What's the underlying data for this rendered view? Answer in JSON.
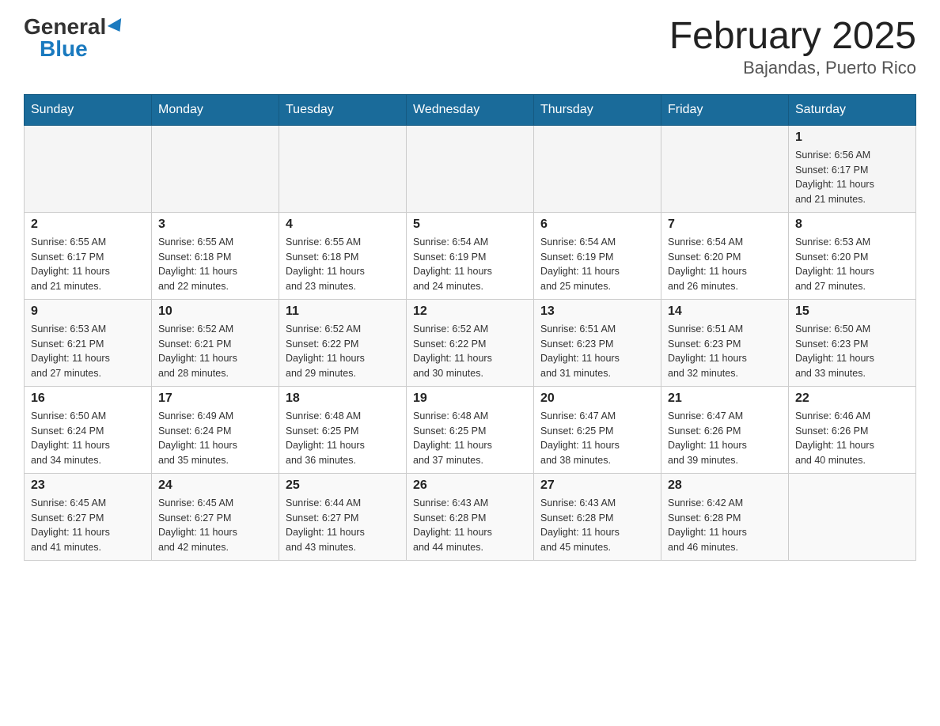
{
  "header": {
    "logo_general": "General",
    "logo_blue": "Blue",
    "title": "February 2025",
    "subtitle": "Bajandas, Puerto Rico"
  },
  "weekdays": [
    "Sunday",
    "Monday",
    "Tuesday",
    "Wednesday",
    "Thursday",
    "Friday",
    "Saturday"
  ],
  "weeks": [
    {
      "days": [
        {
          "num": "",
          "info": ""
        },
        {
          "num": "",
          "info": ""
        },
        {
          "num": "",
          "info": ""
        },
        {
          "num": "",
          "info": ""
        },
        {
          "num": "",
          "info": ""
        },
        {
          "num": "",
          "info": ""
        },
        {
          "num": "1",
          "info": "Sunrise: 6:56 AM\nSunset: 6:17 PM\nDaylight: 11 hours\nand 21 minutes."
        }
      ]
    },
    {
      "days": [
        {
          "num": "2",
          "info": "Sunrise: 6:55 AM\nSunset: 6:17 PM\nDaylight: 11 hours\nand 21 minutes."
        },
        {
          "num": "3",
          "info": "Sunrise: 6:55 AM\nSunset: 6:18 PM\nDaylight: 11 hours\nand 22 minutes."
        },
        {
          "num": "4",
          "info": "Sunrise: 6:55 AM\nSunset: 6:18 PM\nDaylight: 11 hours\nand 23 minutes."
        },
        {
          "num": "5",
          "info": "Sunrise: 6:54 AM\nSunset: 6:19 PM\nDaylight: 11 hours\nand 24 minutes."
        },
        {
          "num": "6",
          "info": "Sunrise: 6:54 AM\nSunset: 6:19 PM\nDaylight: 11 hours\nand 25 minutes."
        },
        {
          "num": "7",
          "info": "Sunrise: 6:54 AM\nSunset: 6:20 PM\nDaylight: 11 hours\nand 26 minutes."
        },
        {
          "num": "8",
          "info": "Sunrise: 6:53 AM\nSunset: 6:20 PM\nDaylight: 11 hours\nand 27 minutes."
        }
      ]
    },
    {
      "days": [
        {
          "num": "9",
          "info": "Sunrise: 6:53 AM\nSunset: 6:21 PM\nDaylight: 11 hours\nand 27 minutes."
        },
        {
          "num": "10",
          "info": "Sunrise: 6:52 AM\nSunset: 6:21 PM\nDaylight: 11 hours\nand 28 minutes."
        },
        {
          "num": "11",
          "info": "Sunrise: 6:52 AM\nSunset: 6:22 PM\nDaylight: 11 hours\nand 29 minutes."
        },
        {
          "num": "12",
          "info": "Sunrise: 6:52 AM\nSunset: 6:22 PM\nDaylight: 11 hours\nand 30 minutes."
        },
        {
          "num": "13",
          "info": "Sunrise: 6:51 AM\nSunset: 6:23 PM\nDaylight: 11 hours\nand 31 minutes."
        },
        {
          "num": "14",
          "info": "Sunrise: 6:51 AM\nSunset: 6:23 PM\nDaylight: 11 hours\nand 32 minutes."
        },
        {
          "num": "15",
          "info": "Sunrise: 6:50 AM\nSunset: 6:23 PM\nDaylight: 11 hours\nand 33 minutes."
        }
      ]
    },
    {
      "days": [
        {
          "num": "16",
          "info": "Sunrise: 6:50 AM\nSunset: 6:24 PM\nDaylight: 11 hours\nand 34 minutes."
        },
        {
          "num": "17",
          "info": "Sunrise: 6:49 AM\nSunset: 6:24 PM\nDaylight: 11 hours\nand 35 minutes."
        },
        {
          "num": "18",
          "info": "Sunrise: 6:48 AM\nSunset: 6:25 PM\nDaylight: 11 hours\nand 36 minutes."
        },
        {
          "num": "19",
          "info": "Sunrise: 6:48 AM\nSunset: 6:25 PM\nDaylight: 11 hours\nand 37 minutes."
        },
        {
          "num": "20",
          "info": "Sunrise: 6:47 AM\nSunset: 6:25 PM\nDaylight: 11 hours\nand 38 minutes."
        },
        {
          "num": "21",
          "info": "Sunrise: 6:47 AM\nSunset: 6:26 PM\nDaylight: 11 hours\nand 39 minutes."
        },
        {
          "num": "22",
          "info": "Sunrise: 6:46 AM\nSunset: 6:26 PM\nDaylight: 11 hours\nand 40 minutes."
        }
      ]
    },
    {
      "days": [
        {
          "num": "23",
          "info": "Sunrise: 6:45 AM\nSunset: 6:27 PM\nDaylight: 11 hours\nand 41 minutes."
        },
        {
          "num": "24",
          "info": "Sunrise: 6:45 AM\nSunset: 6:27 PM\nDaylight: 11 hours\nand 42 minutes."
        },
        {
          "num": "25",
          "info": "Sunrise: 6:44 AM\nSunset: 6:27 PM\nDaylight: 11 hours\nand 43 minutes."
        },
        {
          "num": "26",
          "info": "Sunrise: 6:43 AM\nSunset: 6:28 PM\nDaylight: 11 hours\nand 44 minutes."
        },
        {
          "num": "27",
          "info": "Sunrise: 6:43 AM\nSunset: 6:28 PM\nDaylight: 11 hours\nand 45 minutes."
        },
        {
          "num": "28",
          "info": "Sunrise: 6:42 AM\nSunset: 6:28 PM\nDaylight: 11 hours\nand 46 minutes."
        },
        {
          "num": "",
          "info": ""
        }
      ]
    }
  ]
}
